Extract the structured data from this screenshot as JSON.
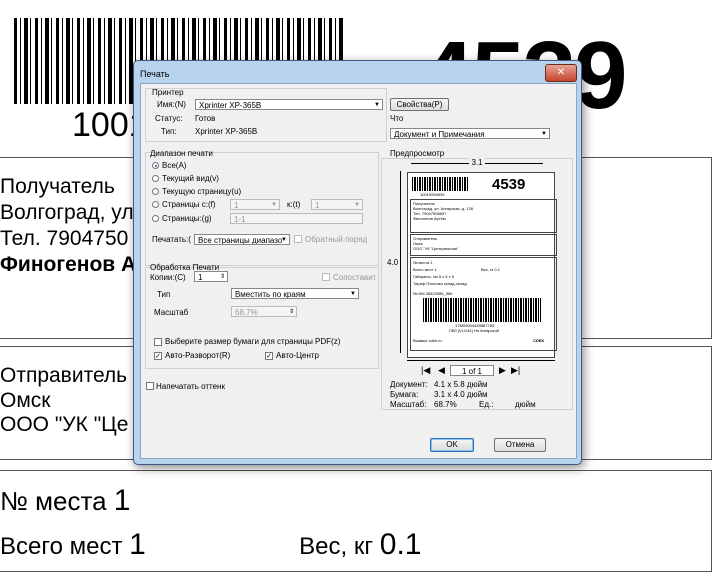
{
  "label": {
    "big_number": "4539",
    "barcode_digits": "1001",
    "recipient": {
      "heading": "Получатель",
      "city": "Волгоград, ул",
      "phone": "Тел. 7904750",
      "name": "Финогенов А"
    },
    "sender": {
      "heading": "Отправитель",
      "city": "Омск",
      "org": "ООО \"УК \"Це"
    },
    "place_label": "№ места",
    "place_value": "1",
    "total_label": "Всего мест",
    "total_value": "1",
    "weight_label": "Вес, кг",
    "weight_value": "0.1"
  },
  "dialog": {
    "title": "Печать",
    "close_icon": "close-icon",
    "printer": {
      "group_label": "Принтер",
      "name_label": "Имя:(N)",
      "name_value": "Xprinter XP-365B",
      "properties_button": "Свойства(P)",
      "status_label": "Статус:",
      "status_value": "Готов",
      "type_label": "Тип:",
      "type_value": "Xprinter XP-365B",
      "what_label": "Что",
      "what_value": "Документ и Примечания"
    },
    "range": {
      "group_label": "Диапазон печати",
      "all": "Все(A)",
      "current_view": "Текущий вид(v)",
      "current_page": "Текущую страницу(u)",
      "pages_from": "Страницы с:(f)",
      "pages_from_value": "1",
      "pages_to_label": "к:(t)",
      "pages_to_value": "1",
      "pages": "Страницы:(g)",
      "pages_value": "1-1",
      "print_label": "Печатать:(",
      "print_value": "Все страницы диапазо",
      "reverse": "Обратный поряд"
    },
    "handling": {
      "group_label": "Обработка Печати",
      "copies_label": "Копии:(C)",
      "copies_value": "1",
      "collate": "Сопоставит",
      "type_label": "Тип",
      "type_value": "Вместить по краям",
      "scale_label": "Масштаб",
      "scale_value": "68.7%",
      "pdf_size": "Выберите размер бумаги для страницы PDF(z)",
      "auto_rotate": "Авто-Разворот(R)",
      "auto_center": "Авто-Центр"
    },
    "grayscale": "Напечатать оттенк",
    "preview": {
      "label": "Предпросмотр",
      "width_dim": "3.1",
      "height_dim": "4.0",
      "page_indicator": "1 of 1",
      "document_label": "Документ:",
      "document_value": "4.1 x 5.8 дюйм",
      "paper_label": "Бумага:",
      "paper_value": "3.1 x 4.0 дюйм",
      "scale_label": "Масштаб:",
      "scale_value": "68.7%",
      "units_label": "Ед.:",
      "units_value": "дюйм",
      "mini": {
        "barcode_digits": "10019284539",
        "big_number": "4539",
        "recipient": [
          "Получатель",
          "Волгоград, ул. Ангарская, д. 126",
          "Тел. 79047506697",
          "Финогенов Артём"
        ],
        "sender": [
          "Отправитель",
          "Омск",
          "ООО \"УК \"Центральная\""
        ],
        "place": "№ места 1",
        "total": "Всего мест 1",
        "weight": "Вес, кг 0.1",
        "dims": "Габариты, см 5 x 5 x 5",
        "tariff": "Тариф Посылка склад-склад",
        "im": "№ ИМ 36523985_585",
        "barcode2_digits": "1ТМ09004459887783",
        "pvz": "ПВЗ [VLG44] На Ангарской",
        "footer_left": "Вшавш! cdek.ru",
        "footer_right": "CDEK"
      }
    },
    "ok_button": "OK",
    "cancel_button": "Отмена"
  }
}
